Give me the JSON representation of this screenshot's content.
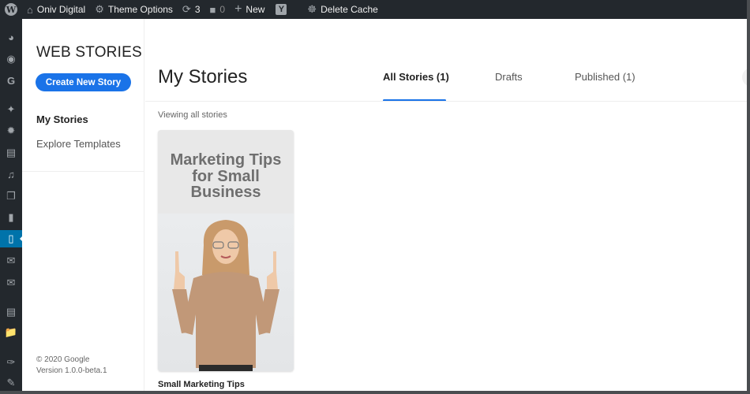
{
  "admin_bar": {
    "site_name": "Oniv Digital",
    "theme_options": "Theme Options",
    "updates_count": "3",
    "comments_count": "0",
    "new_label": "New",
    "yoast_icon": "Y",
    "delete_cache": "Delete Cache"
  },
  "admin_menu": {
    "icons": [
      "dashboard-icon",
      "jetpack-icon",
      "google-icon",
      "pin-icon",
      "gear-cog-icon",
      "media-icon",
      "pages-icon",
      "copy-icon",
      "comments-icon",
      "web-stories-icon",
      "mail-icon",
      "mail-icon",
      "elementor-icon",
      "folder-icon",
      "brush-icon",
      "plugin-icon"
    ],
    "active": "web-stories-icon"
  },
  "sidebar": {
    "title": "WEB STORIES",
    "create_button": "Create New Story",
    "nav": [
      {
        "label": "My Stories",
        "active": true
      },
      {
        "label": "Explore Templates",
        "active": false
      }
    ],
    "footer": {
      "copyright": "© 2020 Google",
      "version": "Version 1.0.0-beta.1"
    }
  },
  "main": {
    "title": "My Stories",
    "tabs": [
      {
        "label": "All Stories (1)",
        "active": true
      },
      {
        "label": "Drafts",
        "active": false
      },
      {
        "label": "Published (1)",
        "active": false
      }
    ],
    "viewing_label": "Viewing all stories",
    "stories": [
      {
        "cover_text": "Marketing Tips for Small Business",
        "title": "Small Marketing Tips"
      }
    ]
  },
  "colors": {
    "accent": "#1a73e8",
    "admin_bar": "#23282d",
    "admin_active": "#0073aa"
  }
}
